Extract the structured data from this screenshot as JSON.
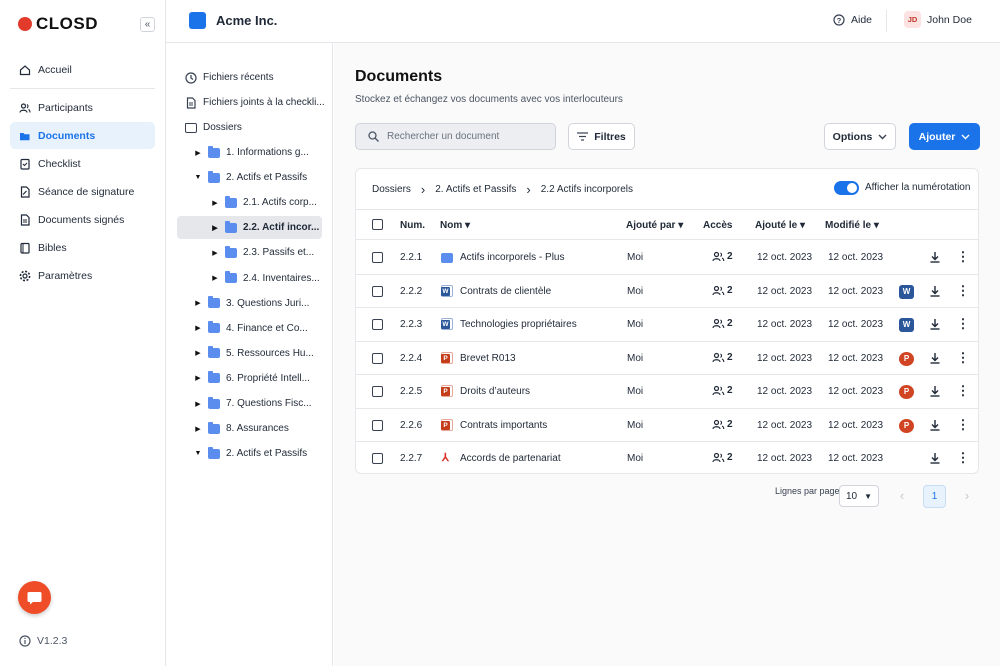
{
  "brand": {
    "name": "CLOSD",
    "collapse_glyph": "«"
  },
  "sidebar": {
    "items": [
      {
        "label": "Accueil",
        "icon": "home-icon"
      },
      {
        "label": "Participants",
        "icon": "users-icon"
      },
      {
        "label": "Documents",
        "icon": "folder-open-icon",
        "active": true
      },
      {
        "label": "Checklist",
        "icon": "checklist-icon"
      },
      {
        "label": "Séance de signature",
        "icon": "signature-icon"
      },
      {
        "label": "Documents signés",
        "icon": "signed-document-icon"
      },
      {
        "label": "Bibles",
        "icon": "book-icon"
      },
      {
        "label": "Paramètres",
        "icon": "gear-icon"
      }
    ],
    "version": "V1.2.3"
  },
  "header": {
    "company": "Acme Inc.",
    "help": "Aide",
    "user_initials": "JD",
    "user_name": "John Doe"
  },
  "tree": {
    "recent": "Fichiers récents",
    "attached": "Fichiers joints à la checkli...",
    "folders_root": "Dossiers",
    "items": [
      {
        "label": "1. Informations g...",
        "expanded": false
      },
      {
        "label": "2. Actifs et Passifs",
        "expanded": true
      },
      {
        "label": "2.1. Actifs corp...",
        "expanded": false
      },
      {
        "label": "2.2. Actif incor...",
        "expanded": false,
        "selected": true
      },
      {
        "label": "2.3. Passifs et...",
        "expanded": false
      },
      {
        "label": "2.4. Inventaires...",
        "expanded": false
      },
      {
        "label": "3. Questions Juri...",
        "expanded": false
      },
      {
        "label": "4. Finance et Co...",
        "expanded": false
      },
      {
        "label": "5. Ressources Hu...",
        "expanded": false
      },
      {
        "label": "6. Propriété Intell...",
        "expanded": false
      },
      {
        "label": "7. Questions Fisc...",
        "expanded": false
      },
      {
        "label": "8. Assurances",
        "expanded": false
      },
      {
        "label": "2. Actifs et Passifs",
        "expanded": true
      }
    ]
  },
  "main": {
    "title": "Documents",
    "subtitle": "Stockez et échangez vos documents avec vos interlocuteurs",
    "search_placeholder": "Rechercher un document",
    "filters": "Filtres",
    "options": "Options",
    "add": "Ajouter",
    "breadcrumb": [
      "Dossiers",
      "2. Actifs et Passifs",
      "2.2 Actifs incorporels"
    ],
    "numbering_label": "Afficher la numérotation",
    "numbering_on": true,
    "columns": {
      "num": "Num.",
      "name": "Nom",
      "added_by": "Ajouté par",
      "access": "Accès",
      "added_on": "Ajouté le",
      "modified_on": "Modifié le"
    },
    "rows": [
      {
        "num": "2.2.1",
        "name": "Actifs incorporels - Plus",
        "type": "folder",
        "added_by": "Moi",
        "access": "2",
        "added_on": "12 oct. 2023",
        "modified_on": "12 oct. 2023",
        "app": ""
      },
      {
        "num": "2.2.2",
        "name": "Contrats de clientèle",
        "type": "word",
        "added_by": "Moi",
        "access": "2",
        "added_on": "12 oct. 2023",
        "modified_on": "12 oct. 2023",
        "app": "W"
      },
      {
        "num": "2.2.3",
        "name": "Technologies propriétaires",
        "type": "word",
        "added_by": "Moi",
        "access": "2",
        "added_on": "12 oct. 2023",
        "modified_on": "12 oct. 2023",
        "app": "W"
      },
      {
        "num": "2.2.4",
        "name": "Brevet R013",
        "type": "ppt",
        "added_by": "Moi",
        "access": "2",
        "added_on": "12 oct. 2023",
        "modified_on": "12 oct. 2023",
        "app": "P"
      },
      {
        "num": "2.2.5",
        "name": "Droits d’auteurs",
        "type": "ppt",
        "added_by": "Moi",
        "access": "2",
        "added_on": "12 oct. 2023",
        "modified_on": "12 oct. 2023",
        "app": "P"
      },
      {
        "num": "2.2.6",
        "name": "Contrats importants",
        "type": "ppt",
        "added_by": "Moi",
        "access": "2",
        "added_on": "12 oct. 2023",
        "modified_on": "12 oct. 2023",
        "app": "P"
      },
      {
        "num": "2.2.7",
        "name": "Accords de partenariat",
        "type": "pdf",
        "added_by": "Moi",
        "access": "2",
        "added_on": "12 oct. 2023",
        "modified_on": "12 oct. 2023",
        "app": ""
      }
    ],
    "pagination": {
      "rows_label": "Lignes par page",
      "rows_value": "10",
      "page": "1"
    }
  },
  "colors": {
    "accent": "#1a73e8",
    "brand_red": "#e23b2c",
    "chat": "#ef4c28"
  }
}
